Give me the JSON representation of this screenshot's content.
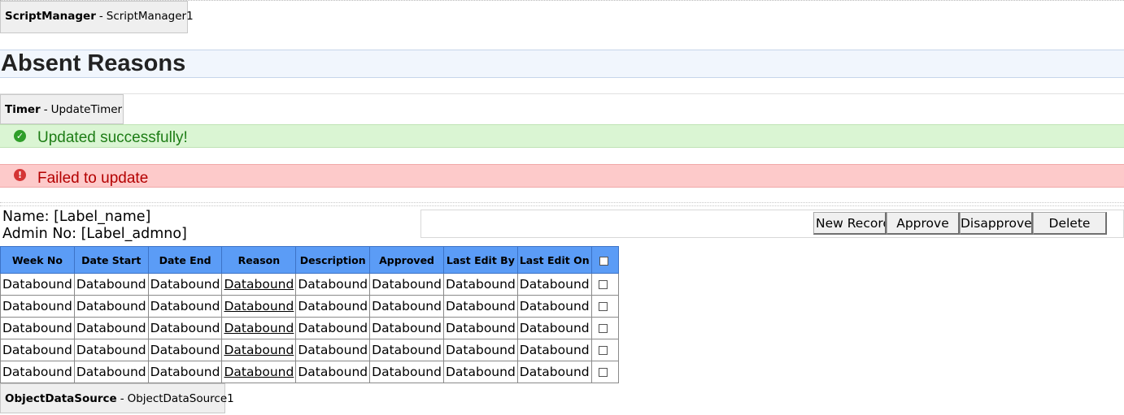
{
  "script_manager": {
    "type": "ScriptManager",
    "separator": "-",
    "id": "ScriptManager1"
  },
  "page_title": "Absent Reasons",
  "timer": {
    "type": "Timer",
    "separator": "-",
    "id": "UpdateTimer"
  },
  "alerts": {
    "success": {
      "text": "Updated successfully!",
      "icon": "check-circle-icon",
      "color": "#1e7d16",
      "icon_glyph": "✓"
    },
    "error": {
      "text": "Failed to update",
      "icon": "exclamation-circle-icon",
      "color": "#b40000",
      "icon_glyph": "!"
    }
  },
  "info": {
    "name": "Name: [Label_name]",
    "admin_no": "Admin No: [Label_admno]"
  },
  "buttons": {
    "new_record": "New Record",
    "approve": "Approve",
    "disapprove": "Disapprove",
    "delete": "Delete"
  },
  "grid": {
    "header_color": "#5b9cf6",
    "columns": [
      "Week No",
      "Date Start",
      "Date End",
      "Reason",
      "Description",
      "Approved",
      "Last Edit By",
      "Last Edit On"
    ],
    "link_column": "Reason",
    "rows": [
      [
        "Databound",
        "Databound",
        "Databound",
        "Databound",
        "Databound",
        "Databound",
        "Databound",
        "Databound"
      ],
      [
        "Databound",
        "Databound",
        "Databound",
        "Databound",
        "Databound",
        "Databound",
        "Databound",
        "Databound"
      ],
      [
        "Databound",
        "Databound",
        "Databound",
        "Databound",
        "Databound",
        "Databound",
        "Databound",
        "Databound"
      ],
      [
        "Databound",
        "Databound",
        "Databound",
        "Databound",
        "Databound",
        "Databound",
        "Databound",
        "Databound"
      ],
      [
        "Databound",
        "Databound",
        "Databound",
        "Databound",
        "Databound",
        "Databound",
        "Databound",
        "Databound"
      ]
    ]
  },
  "object_data_source": {
    "type": "ObjectDataSource",
    "separator": "-",
    "id": "ObjectDataSource1"
  }
}
